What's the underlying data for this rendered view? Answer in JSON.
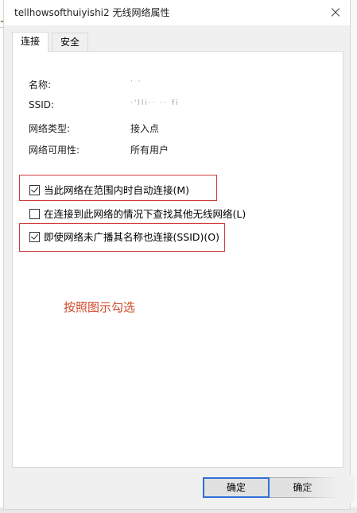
{
  "window": {
    "title": "tellhowsofthuiyishi2 无线网络属性"
  },
  "tabs": [
    {
      "label": "连接"
    },
    {
      "label": "安全"
    }
  ],
  "properties": [
    {
      "label": "名称:",
      "value": "· ·"
    },
    {
      "label": "SSID:",
      "value": "·'lli·· ·· fi"
    },
    {
      "label": "网络类型:",
      "value": "接入点"
    },
    {
      "label": "网络可用性:",
      "value": "所有用户"
    }
  ],
  "options": [
    {
      "label": "当此网络在范围内时自动连接(M)",
      "checked": true
    },
    {
      "label": "在连接到此网络的情况下查找其他无线网络(L)",
      "checked": false
    },
    {
      "label": "即使网络未广播其名称也连接(SSID)(O)",
      "checked": true
    }
  ],
  "annotation": {
    "text": "按照图示勾选",
    "color": "#d04a2b"
  },
  "buttons": {
    "ok_label": "确定",
    "ok2_label": "确定"
  },
  "colors": {
    "highlight_box": "#cf3b3b",
    "default_button_border": "#2f6fd6"
  }
}
